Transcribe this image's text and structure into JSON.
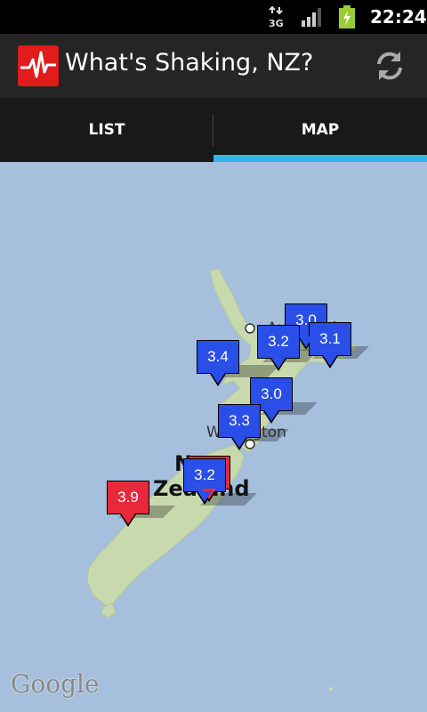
{
  "status_bar": {
    "network": "3G",
    "time": "22:24",
    "icons": [
      "network-3g-icon",
      "signal-icon",
      "battery-charging-icon"
    ]
  },
  "action_bar": {
    "title": "What's Shaking, NZ?",
    "app_icon": "seismograph-icon",
    "refresh_icon": "refresh-icon"
  },
  "tabs": [
    {
      "label": "LIST",
      "selected": false
    },
    {
      "label": "MAP",
      "selected": true
    }
  ],
  "map": {
    "labels": {
      "auckland": "Auckland",
      "wellington": "Wellington",
      "country_line1": "New",
      "country_line2": "Zealand"
    },
    "attribution": "Google",
    "markers": [
      {
        "magnitude": "3.0",
        "color": "blue"
      },
      {
        "magnitude": "3.2",
        "color": "blue"
      },
      {
        "magnitude": "3.1",
        "color": "blue"
      },
      {
        "magnitude": "3.4",
        "color": "blue"
      },
      {
        "magnitude": "3.0",
        "color": "blue"
      },
      {
        "magnitude": "3.3",
        "color": "blue"
      },
      {
        "magnitude": "3.2",
        "color": "blue"
      },
      {
        "magnitude": "3.9",
        "color": "red"
      }
    ]
  },
  "colors": {
    "accent": "#33b5e5",
    "marker_blue": "#2a4ee8",
    "marker_red": "#e8293b",
    "app_icon_red": "#e21b1b",
    "sea": "#a5bfdd",
    "land": "#c9d9ae"
  }
}
